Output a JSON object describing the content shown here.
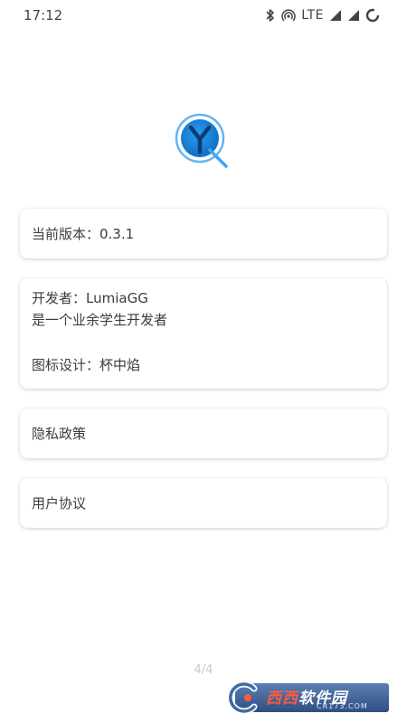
{
  "status_bar": {
    "time": "17:12",
    "network": "LTE",
    "icons": [
      "bluetooth-icon",
      "hotspot-icon",
      "signal-icon",
      "signal-icon",
      "battery-loading-icon"
    ]
  },
  "app": {
    "logo_icon": "app-logo-icon",
    "accent_color": "#1e88e5"
  },
  "version_card": {
    "text": "当前版本：0.3.1"
  },
  "developer_card": {
    "developer": "开发者：LumiaGG",
    "bio": "是一个业余学生开发者",
    "icon_design": "图标设计：杯中焰"
  },
  "privacy_card": {
    "label": "隐私政策"
  },
  "agreement_card": {
    "label": "用户协议"
  },
  "pager": {
    "text": "4/4"
  },
  "watermark": {
    "brand_part1": "西西",
    "brand_part2": "软件园",
    "domain": "CR173.COM"
  }
}
